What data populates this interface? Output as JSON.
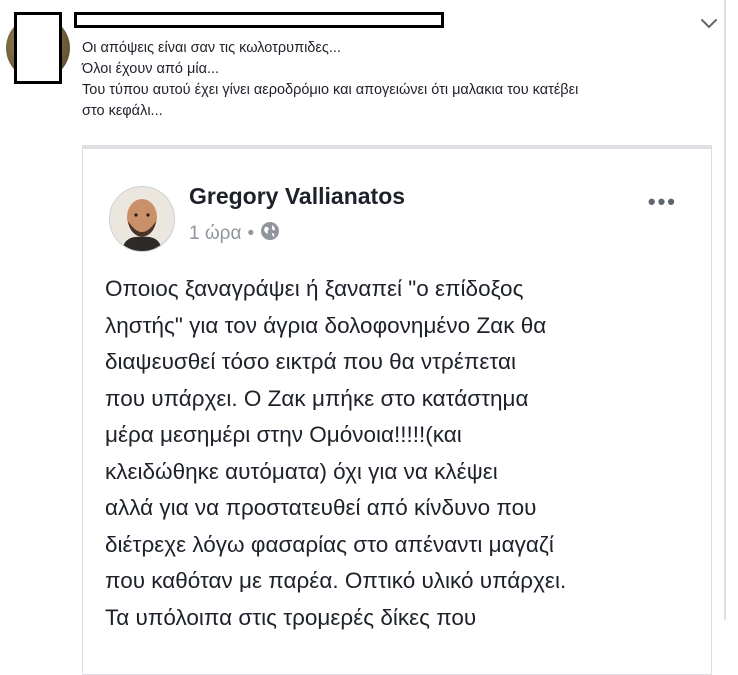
{
  "comment": {
    "lines": [
      "Οι απόψεις είναι σαν τις κωλοτρυπιδες...",
      "Όλοι έχουν από μία...",
      "Του τύπου αυτού έχει γίνει αεροδρόμιο και απογειώνει ότι μαλακια του κατέβει",
      "στο κεφάλι..."
    ],
    "menu_icon": "chevron-down-icon"
  },
  "shared_post": {
    "author": "Gregory Vallianatos",
    "time": "1 ώρα",
    "separator": "•",
    "privacy_icon": "globe-icon",
    "more_label": "•••",
    "body_lines": [
      "Οποιος ξαναγράψει ή ξαναπεί \"ο επίδοξος",
      "ληστής\" για τον άγρια δολοφονημένο Ζακ θα",
      "διαψευσθεί τόσο εικτρά που θα ντρέπεται",
      "που υπάρχει. Ο Ζακ μπήκε στο κατάστημα",
      "μέρα μεσημέρι στην Ομόνοια!!!!!(και",
      "κλειδώθηκε αυτόματα) όχι για να κλέψει",
      "αλλά για να προστατευθεί από κίνδυνο που",
      "διέτρεχε λόγω φασαρίας στο απέναντι μαγαζί",
      "που καθόταν με παρέα. Οπτικό υλικό υπάρχει.",
      "Τα υπόλοιπα στις τρομερές δίκες που"
    ]
  }
}
